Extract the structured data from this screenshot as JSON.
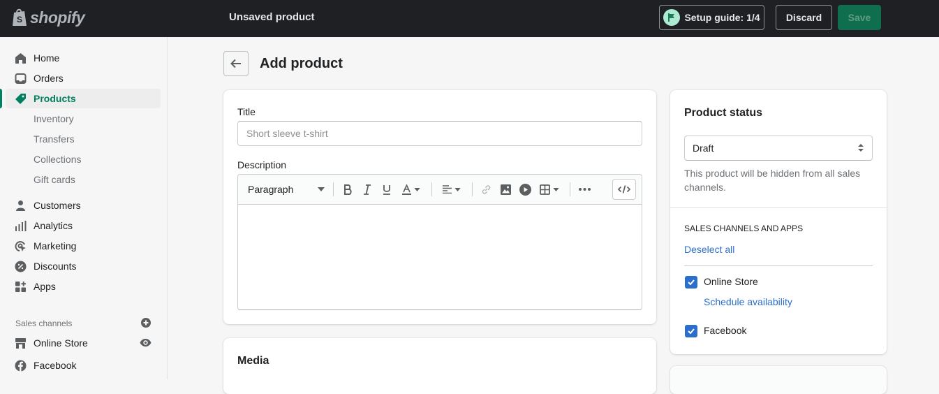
{
  "topbar": {
    "logo_text": "shopify",
    "page_status": "Unsaved product",
    "setup_guide_label": "Setup guide: 1/4",
    "discard_label": "Discard",
    "save_label": "Save"
  },
  "sidebar": {
    "items": [
      {
        "label": "Home",
        "icon": "home-icon"
      },
      {
        "label": "Orders",
        "icon": "orders-icon"
      },
      {
        "label": "Products",
        "icon": "tag-icon",
        "active": true
      },
      {
        "label": "Inventory"
      },
      {
        "label": "Transfers"
      },
      {
        "label": "Collections"
      },
      {
        "label": "Gift cards"
      },
      {
        "label": "Customers",
        "icon": "person-icon"
      },
      {
        "label": "Analytics",
        "icon": "bar-chart-icon"
      },
      {
        "label": "Marketing",
        "icon": "target-icon"
      },
      {
        "label": "Discounts",
        "icon": "discount-icon"
      },
      {
        "label": "Apps",
        "icon": "apps-icon"
      }
    ],
    "sales_channels_title": "Sales channels",
    "channels": [
      {
        "label": "Online Store",
        "icon": "store-icon"
      },
      {
        "label": "Facebook",
        "icon": "facebook-icon"
      }
    ]
  },
  "main": {
    "page_title": "Add product",
    "title_label": "Title",
    "title_placeholder": "Short sleeve t-shirt",
    "title_value": "",
    "description_label": "Description",
    "editor": {
      "format_select": "Paragraph",
      "tools": [
        "bold",
        "italic",
        "underline",
        "text-color",
        "align",
        "link",
        "image",
        "video",
        "table",
        "more",
        "html"
      ]
    },
    "media_title": "Media"
  },
  "status_card": {
    "title": "Product status",
    "selected_status": "Draft",
    "help_text": "This product will be hidden from all sales channels.",
    "sales_channels_heading": "SALES CHANNELS AND APPS",
    "deselect_all": "Deselect all",
    "channels": [
      {
        "label": "Online Store",
        "checked": true,
        "link": "Schedule availability"
      },
      {
        "label": "Facebook",
        "checked": true
      }
    ]
  },
  "colors": {
    "accent": "#008060",
    "link": "#2c6ecb",
    "topbar": "#1f2023",
    "checkbox": "#2c6ecb"
  }
}
